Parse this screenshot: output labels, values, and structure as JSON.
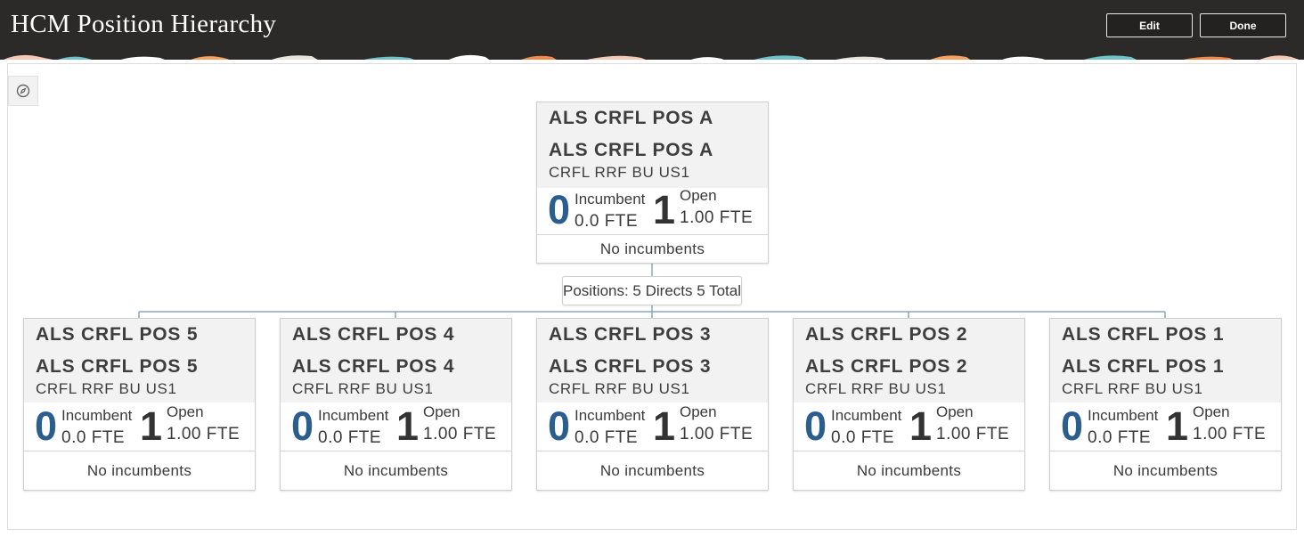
{
  "header": {
    "title": "HCM Position Hierarchy",
    "edit_label": "Edit",
    "done_label": "Done"
  },
  "toolbar": {
    "compass_icon": "compass-icon"
  },
  "colors": {
    "header_bg": "#2b2a29",
    "incumbent_count": "#2b5e8f",
    "card_header_bg": "#f2f2f2",
    "connector": "#8aa6c2"
  },
  "root": {
    "title": "ALS CRFL POS A",
    "name": "ALS CRFL POS A",
    "business_unit": "CRFL RRF BU US1",
    "incumbent_count": "0",
    "incumbent_label": "Incumbent",
    "incumbent_fte": "0.0 FTE",
    "open_count": "1",
    "open_label": "Open",
    "open_fte": "1.00 FTE",
    "footer": "No incumbents"
  },
  "summary": "Positions: 5 Directs 5 Total",
  "children": [
    {
      "title": "ALS CRFL POS 5",
      "name": "ALS CRFL POS 5",
      "business_unit": "CRFL RRF BU US1",
      "incumbent_count": "0",
      "incumbent_label": "Incumbent",
      "incumbent_fte": "0.0 FTE",
      "open_count": "1",
      "open_label": "Open",
      "open_fte": "1.00 FTE",
      "footer": "No incumbents"
    },
    {
      "title": "ALS CRFL POS 4",
      "name": "ALS CRFL POS 4",
      "business_unit": "CRFL RRF BU US1",
      "incumbent_count": "0",
      "incumbent_label": "Incumbent",
      "incumbent_fte": "0.0 FTE",
      "open_count": "1",
      "open_label": "Open",
      "open_fte": "1.00 FTE",
      "footer": "No incumbents"
    },
    {
      "title": "ALS CRFL POS 3",
      "name": "ALS CRFL POS 3",
      "business_unit": "CRFL RRF BU US1",
      "incumbent_count": "0",
      "incumbent_label": "Incumbent",
      "incumbent_fte": "0.0 FTE",
      "open_count": "1",
      "open_label": "Open",
      "open_fte": "1.00 FTE",
      "footer": "No incumbents"
    },
    {
      "title": "ALS CRFL POS 2",
      "name": "ALS CRFL POS 2",
      "business_unit": "CRFL RRF BU US1",
      "incumbent_count": "0",
      "incumbent_label": "Incumbent",
      "incumbent_fte": "0.0 FTE",
      "open_count": "1",
      "open_label": "Open",
      "open_fte": "1.00 FTE",
      "footer": "No incumbents"
    },
    {
      "title": "ALS CRFL POS 1",
      "name": "ALS CRFL POS 1",
      "business_unit": "CRFL RRF BU US1",
      "incumbent_count": "0",
      "incumbent_label": "Incumbent",
      "incumbent_fte": "0.0 FTE",
      "open_count": "1",
      "open_label": "Open",
      "open_fte": "1.00 FTE",
      "footer": "No incumbents"
    }
  ]
}
